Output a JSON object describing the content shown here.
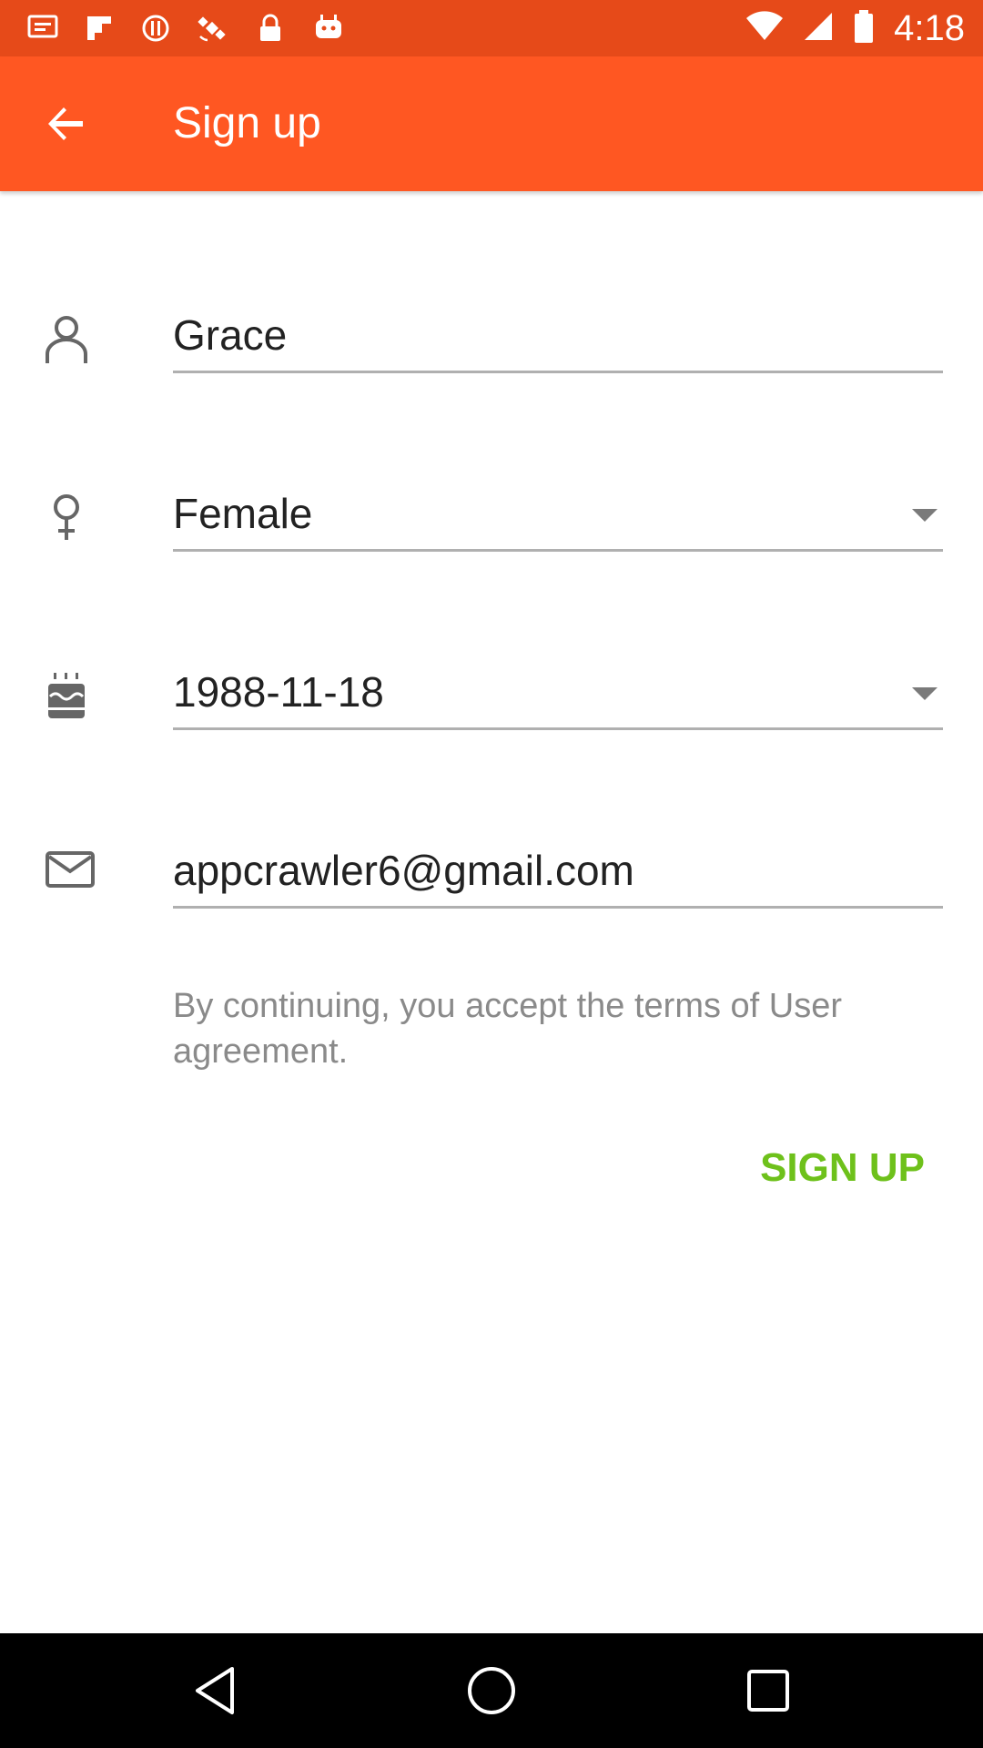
{
  "status_bar": {
    "time": "4:18",
    "icons": [
      "message-icon",
      "flipboard-icon",
      "alert-icon",
      "satellite-icon",
      "lock-icon",
      "android-icon"
    ],
    "right_icons": [
      "wifi-icon",
      "signal-icon",
      "battery-icon"
    ]
  },
  "app_bar": {
    "title": "Sign up",
    "back_icon": "arrow-back-icon"
  },
  "form": {
    "name": {
      "icon": "person-icon",
      "value": "Grace"
    },
    "gender": {
      "icon": "female-icon",
      "value": "Female"
    },
    "birthday": {
      "icon": "cake-icon",
      "value": "1988-11-18"
    },
    "email": {
      "icon": "mail-icon",
      "value": "appcrawler6@gmail.com"
    }
  },
  "terms_text": "By continuing, you accept the terms of User agreement.",
  "signup_label": "SIGN UP",
  "colors": {
    "status_bar": "#E64A19",
    "app_bar": "#FF5722",
    "accent_green": "#6EC11B",
    "nav_bar": "#000000"
  },
  "nav": [
    "back-icon",
    "home-icon",
    "recents-icon"
  ]
}
